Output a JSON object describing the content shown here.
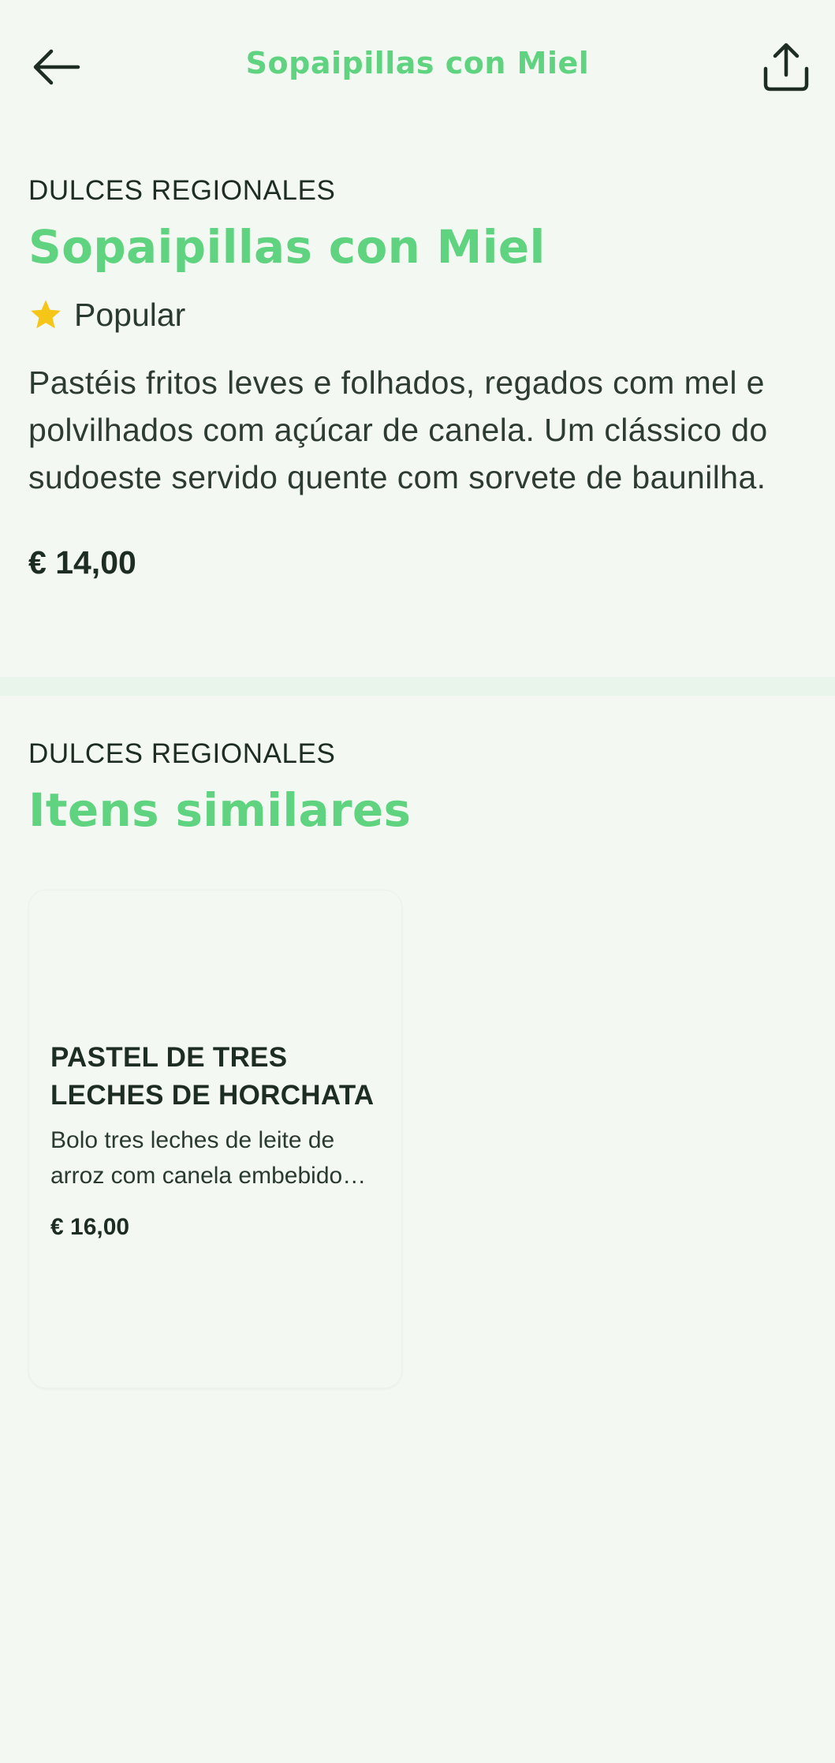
{
  "header": {
    "title": "Sopaipillas con Miel",
    "back_icon": "arrow-left-icon",
    "share_icon": "share-icon"
  },
  "product": {
    "category": "DULCES REGIONALES",
    "name": "Sopaipillas con Miel",
    "badge": "Popular",
    "badge_icon": "star-icon",
    "description": "Pastéis fritos leves e folhados, regados com mel e polvilhados com açúcar de canela. Um clássico do sudoeste servido quente com sorvete de baunilha.",
    "price": "€ 14,00"
  },
  "similar": {
    "category": "DULCES REGIONALES",
    "title": "Itens similares",
    "items": [
      {
        "title": "PASTEL DE TRES LECHES DE HORCHATA",
        "description": "Bolo tres leches de leite de arroz com canela embebido…",
        "price": "€ 16,00"
      }
    ]
  },
  "colors": {
    "background": "#f3f8f2",
    "accent": "#5fd37f",
    "text": "#1e2d24",
    "star": "#f5c518",
    "divider": "#e9f4ea"
  }
}
